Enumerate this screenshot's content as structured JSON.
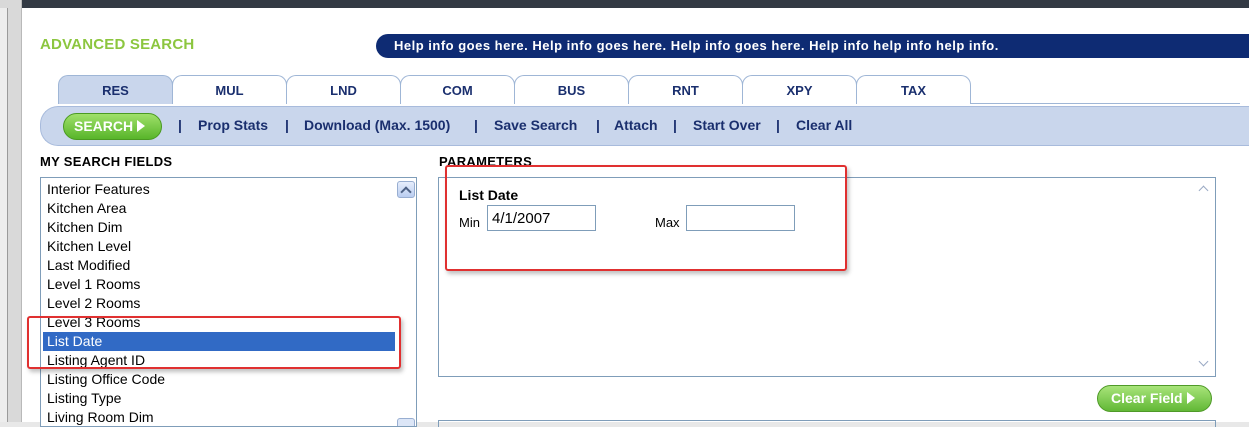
{
  "header": {
    "title": "ADVANCED SEARCH",
    "help_text": "Help info goes here. Help info goes here. Help info goes here. Help info help info help info."
  },
  "tabs": [
    {
      "label": "RES",
      "active": true
    },
    {
      "label": "MUL",
      "active": false
    },
    {
      "label": "LND",
      "active": false
    },
    {
      "label": "COM",
      "active": false
    },
    {
      "label": "BUS",
      "active": false
    },
    {
      "label": "RNT",
      "active": false
    },
    {
      "label": "XPY",
      "active": false
    },
    {
      "label": "TAX",
      "active": false
    }
  ],
  "toolbar": {
    "search_label": "SEARCH",
    "links": [
      "Prop Stats",
      "Download (Max. 1500)",
      "Save Search",
      "Attach",
      "Start Over",
      "Clear All"
    ],
    "separator": "|"
  },
  "search_fields": {
    "heading": "MY SEARCH FIELDS",
    "items": [
      "Interior Features",
      "Kitchen Area",
      "Kitchen Dim",
      "Kitchen Level",
      "Last Modified",
      "Level 1 Rooms",
      "Level 2 Rooms",
      "Level 3 Rooms",
      "List Date",
      "Listing Agent ID",
      "Listing Office Code",
      "Listing Type",
      "Living Room Dim"
    ],
    "selected": "List Date"
  },
  "parameters": {
    "heading": "PARAMETERS",
    "field_label": "List Date",
    "min_label": "Min",
    "min_value": "4/1/2007",
    "max_label": "Max",
    "max_value": ""
  },
  "clear_field_label": "Clear Field",
  "colors": {
    "title_green": "#8cc63f",
    "help_bar_navy": "#0e2b73",
    "toolbar_blue": "#c9d6ec",
    "selection_blue": "#316ac5",
    "annotation_red": "#e03030"
  },
  "icons": {
    "search_arrow": "triangle-right-icon",
    "list_scroll": "chevron-up-icon"
  }
}
